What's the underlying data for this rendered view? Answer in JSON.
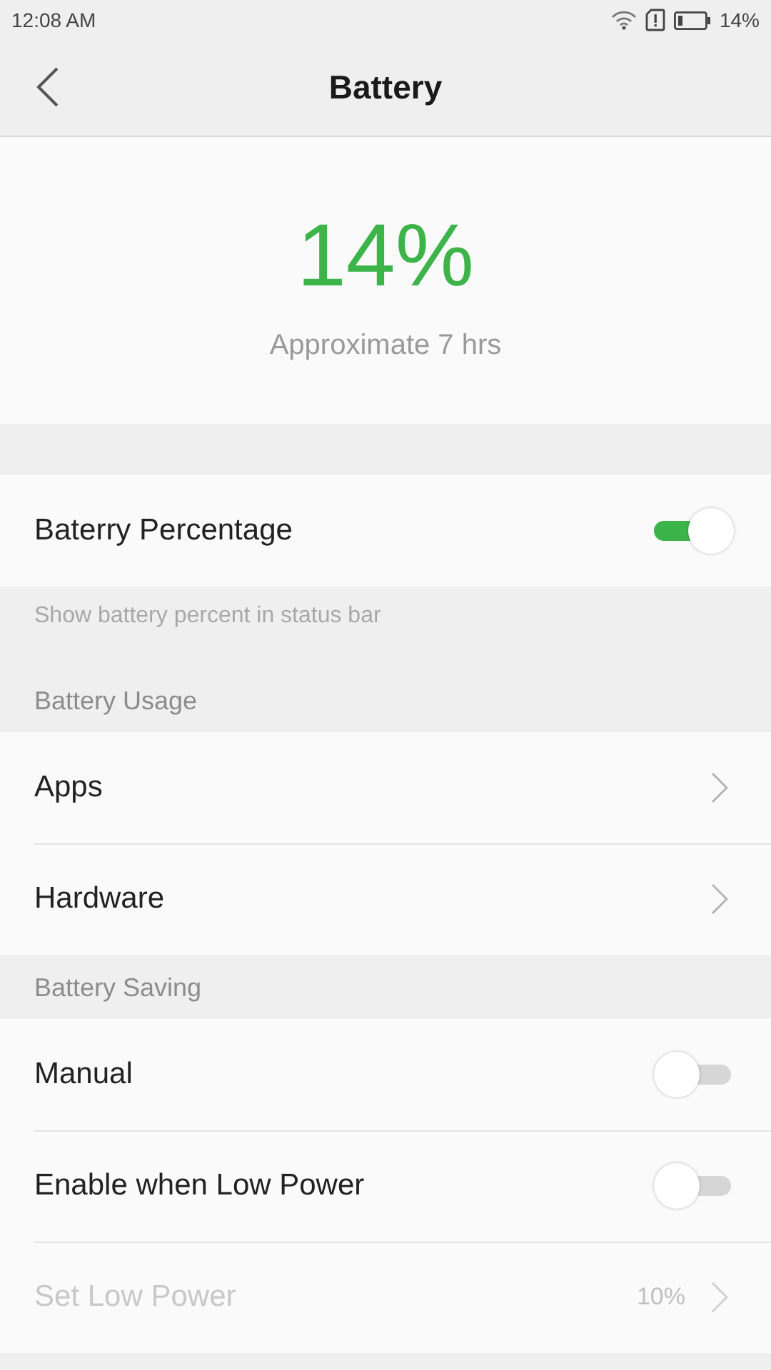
{
  "status_bar": {
    "time": "12:08 AM",
    "battery_text": "14%"
  },
  "header": {
    "title": "Battery"
  },
  "summary": {
    "percent": "14%",
    "estimate": "Approximate 7 hrs"
  },
  "groups": [
    {
      "items": [
        {
          "kind": "toggle",
          "label": "Baterry Percentage",
          "on": true,
          "disabled": false
        }
      ],
      "footer": "Show battery percent in status bar"
    },
    {
      "title": "Battery Usage",
      "items": [
        {
          "kind": "link",
          "label": "Apps",
          "disabled": false
        },
        {
          "kind": "link",
          "label": "Hardware",
          "disabled": false
        }
      ]
    },
    {
      "title": "Battery Saving",
      "items": [
        {
          "kind": "toggle",
          "label": "Manual",
          "on": false,
          "disabled": false
        },
        {
          "kind": "toggle",
          "label": "Enable when Low Power",
          "on": false,
          "disabled": false
        },
        {
          "kind": "link",
          "label": "Set Low Power",
          "value": "10%",
          "disabled": true
        }
      ]
    }
  ]
}
